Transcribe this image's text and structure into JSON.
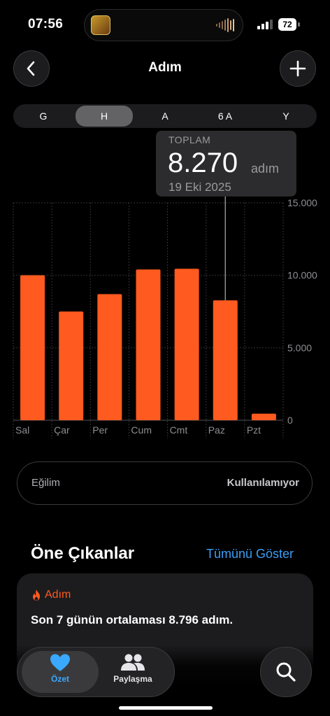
{
  "status_bar": {
    "time": "07:56",
    "battery": "72"
  },
  "header": {
    "title": "Adım"
  },
  "segments": {
    "items": [
      "G",
      "H",
      "A",
      "6 A",
      "Y"
    ],
    "selected": "H"
  },
  "tooltip": {
    "label": "TOPLAM",
    "value": "8.270",
    "unit": "adım",
    "date": "19 Eki 2025"
  },
  "chart_data": {
    "type": "bar",
    "categories": [
      "Sal",
      "Çar",
      "Per",
      "Cum",
      "Cmt",
      "Paz",
      "Pzt"
    ],
    "series": [
      {
        "values": [
          10000,
          7500,
          8700,
          10400,
          10450,
          8270,
          450
        ]
      }
    ],
    "y_ticks": [
      "15.000",
      "10.000",
      "5.000",
      "0"
    ],
    "y_tick_values": [
      15000,
      10000,
      5000,
      0
    ],
    "ylim": [
      0,
      15000
    ],
    "bar_color": "#ff5a1f",
    "grid": true,
    "selected_category": "Paz"
  },
  "trend": {
    "label": "Eğilim",
    "value": "Kullanılamıyor"
  },
  "highlights": {
    "title": "Öne Çıkanlar",
    "show_all": "Tümünü Göster",
    "card": {
      "category": "Adım",
      "icon": "flame-icon",
      "text": "Son 7 günün ortalaması 8.796 adım."
    }
  },
  "tabbar": {
    "summary": "Özet",
    "sharing": "Paylaşma"
  },
  "colors": {
    "accent": "#ff5a1f",
    "link": "#3b9ef5",
    "heart": "#3ba8ff"
  }
}
